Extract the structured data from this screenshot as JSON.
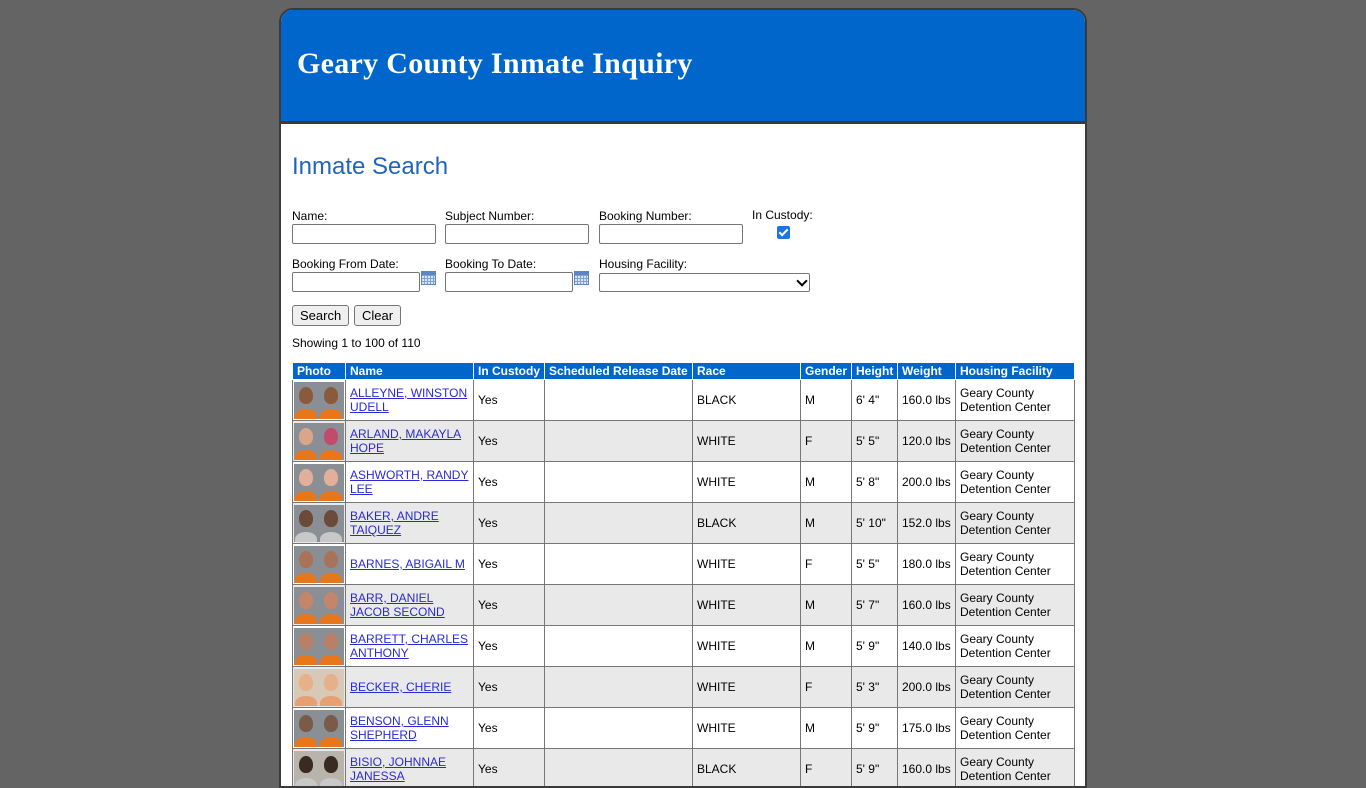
{
  "header": {
    "title": "Geary County Inmate Inquiry"
  },
  "search": {
    "section_title": "Inmate Search",
    "name_label": "Name:",
    "name_value": "",
    "subject_label": "Subject Number:",
    "subject_value": "",
    "booking_label": "Booking Number:",
    "booking_value": "",
    "custody_label": "In Custody:",
    "custody_checked": true,
    "from_label": "Booking From Date:",
    "from_value": "",
    "to_label": "Booking To Date:",
    "to_value": "",
    "facility_label": "Housing Facility:",
    "facility_selected": "",
    "search_button": "Search",
    "clear_button": "Clear"
  },
  "results": {
    "showing": "Showing 1 to 100 of 110",
    "columns": [
      "Photo",
      "Name",
      "In Custody",
      "Scheduled Release Date",
      "Race",
      "Gender",
      "Height",
      "Weight",
      "Housing Facility"
    ],
    "rows": [
      {
        "name": "ALLEYNE, WINSTON UDELL",
        "custody": "Yes",
        "release": "",
        "race": "BLACK",
        "gender": "M",
        "height": "6' 4\"",
        "weight": "160.0 lbs",
        "facility": "Geary County Detention Center"
      },
      {
        "name": "ARLAND, MAKAYLA HOPE",
        "custody": "Yes",
        "release": "",
        "race": "WHITE",
        "gender": "F",
        "height": "5' 5\"",
        "weight": "120.0 lbs",
        "facility": "Geary County Detention Center"
      },
      {
        "name": "ASHWORTH, RANDY LEE",
        "custody": "Yes",
        "release": "",
        "race": "WHITE",
        "gender": "M",
        "height": "5' 8\"",
        "weight": "200.0 lbs",
        "facility": "Geary County Detention Center"
      },
      {
        "name": "BAKER, ANDRE TAIQUEZ",
        "custody": "Yes",
        "release": "",
        "race": "BLACK",
        "gender": "M",
        "height": "5' 10\"",
        "weight": "152.0 lbs",
        "facility": "Geary County Detention Center"
      },
      {
        "name": "BARNES, ABIGAIL M",
        "custody": "Yes",
        "release": "",
        "race": "WHITE",
        "gender": "F",
        "height": "5' 5\"",
        "weight": "180.0 lbs",
        "facility": "Geary County Detention Center"
      },
      {
        "name": "BARR, DANIEL JACOB SECOND",
        "custody": "Yes",
        "release": "",
        "race": "WHITE",
        "gender": "M",
        "height": "5' 7\"",
        "weight": "160.0 lbs",
        "facility": "Geary County Detention Center"
      },
      {
        "name": "BARRETT, CHARLES ANTHONY",
        "custody": "Yes",
        "release": "",
        "race": "WHITE",
        "gender": "M",
        "height": "5' 9\"",
        "weight": "140.0 lbs",
        "facility": "Geary County Detention Center"
      },
      {
        "name": "BECKER, CHERIE",
        "custody": "Yes",
        "release": "",
        "race": "WHITE",
        "gender": "F",
        "height": "5' 3\"",
        "weight": "200.0 lbs",
        "facility": "Geary County Detention Center"
      },
      {
        "name": "BENSON, GLENN SHEPHERD",
        "custody": "Yes",
        "release": "",
        "race": "WHITE",
        "gender": "M",
        "height": "5' 9\"",
        "weight": "175.0 lbs",
        "facility": "Geary County Detention Center"
      },
      {
        "name": "BISIO, JOHNNAE JANESSA",
        "custody": "Yes",
        "release": "",
        "race": "BLACK",
        "gender": "F",
        "height": "5' 9\"",
        "weight": "160.0 lbs",
        "facility": "Geary County Detention Center"
      }
    ]
  }
}
